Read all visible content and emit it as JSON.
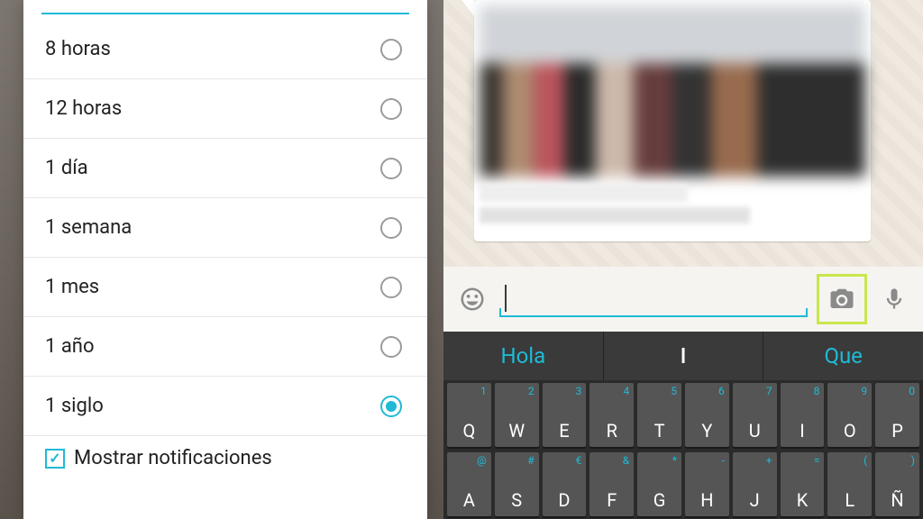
{
  "dialog": {
    "options": [
      {
        "label": "8 horas",
        "selected": false
      },
      {
        "label": "12 horas",
        "selected": false
      },
      {
        "label": "1 día",
        "selected": false
      },
      {
        "label": "1 semana",
        "selected": false
      },
      {
        "label": "1 mes",
        "selected": false
      },
      {
        "label": "1 año",
        "selected": false
      },
      {
        "label": "1 siglo",
        "selected": true
      }
    ],
    "checkbox_label": "Mostrar notificaciones",
    "checkbox_checked": true
  },
  "chat": {
    "input_value": "",
    "suggestions": {
      "left": "Hola",
      "mid": "I",
      "right": "Que"
    }
  },
  "keyboard": {
    "row1": [
      {
        "alt": "1",
        "main": "Q"
      },
      {
        "alt": "2",
        "main": "W"
      },
      {
        "alt": "3",
        "main": "E"
      },
      {
        "alt": "4",
        "main": "R"
      },
      {
        "alt": "5",
        "main": "T"
      },
      {
        "alt": "6",
        "main": "Y"
      },
      {
        "alt": "7",
        "main": "U"
      },
      {
        "alt": "8",
        "main": "I"
      },
      {
        "alt": "9",
        "main": "O"
      },
      {
        "alt": "0",
        "main": "P"
      }
    ],
    "row2": [
      {
        "alt": "@",
        "main": "A"
      },
      {
        "alt": "#",
        "main": "S"
      },
      {
        "alt": "€",
        "main": "D"
      },
      {
        "alt": "&",
        "main": "F"
      },
      {
        "alt": "*",
        "main": "G"
      },
      {
        "alt": "-",
        "main": "H"
      },
      {
        "alt": "+",
        "main": "J"
      },
      {
        "alt": "=",
        "main": "K"
      },
      {
        "alt": "(",
        "main": "L"
      },
      {
        "alt": ")",
        "main": "Ñ"
      }
    ]
  },
  "colors": {
    "accent": "#1fbad6",
    "highlight": "#c9e64b"
  }
}
